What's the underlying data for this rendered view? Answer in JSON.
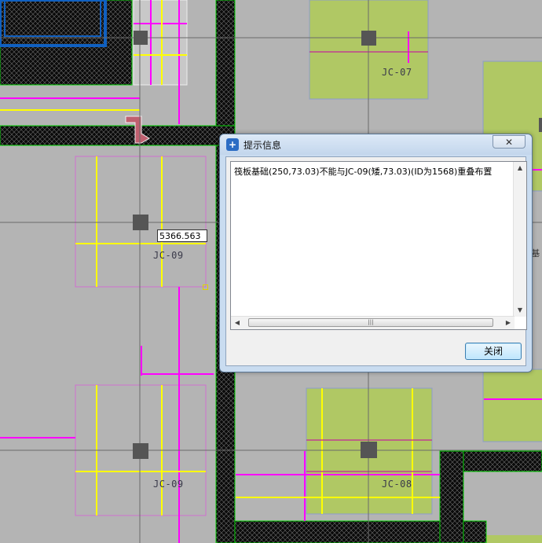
{
  "canvas": {
    "labels": {
      "jc07": "JC-07",
      "jc09_top": "JC-09",
      "jc09_bottom": "JC-09",
      "jc08": "JC-08"
    },
    "coordinate_input_value": "5366.563",
    "edge_text": "(基"
  },
  "dialog": {
    "title": "提示信息",
    "close_glyph": "✕",
    "message": "筏板基础(250,73.03)不能与JC-09(矮,73.03)(ID为1568)重叠布置",
    "close_button_label": "关闭",
    "scroll_thumb_glyph": "|||",
    "scroll_up_glyph": "▲",
    "scroll_down_glyph": "▼",
    "scroll_left_glyph": "◀",
    "scroll_right_glyph": "▶"
  },
  "colors": {
    "canvas_bg": "#b4b4b4",
    "wall_fill": "#0a0a0a",
    "wall_edge": "#00d000",
    "pile_cap_fill": "#b0c864",
    "magenta": "#ff00ff",
    "yellow": "#ffff00",
    "blue": "#1060c0"
  }
}
